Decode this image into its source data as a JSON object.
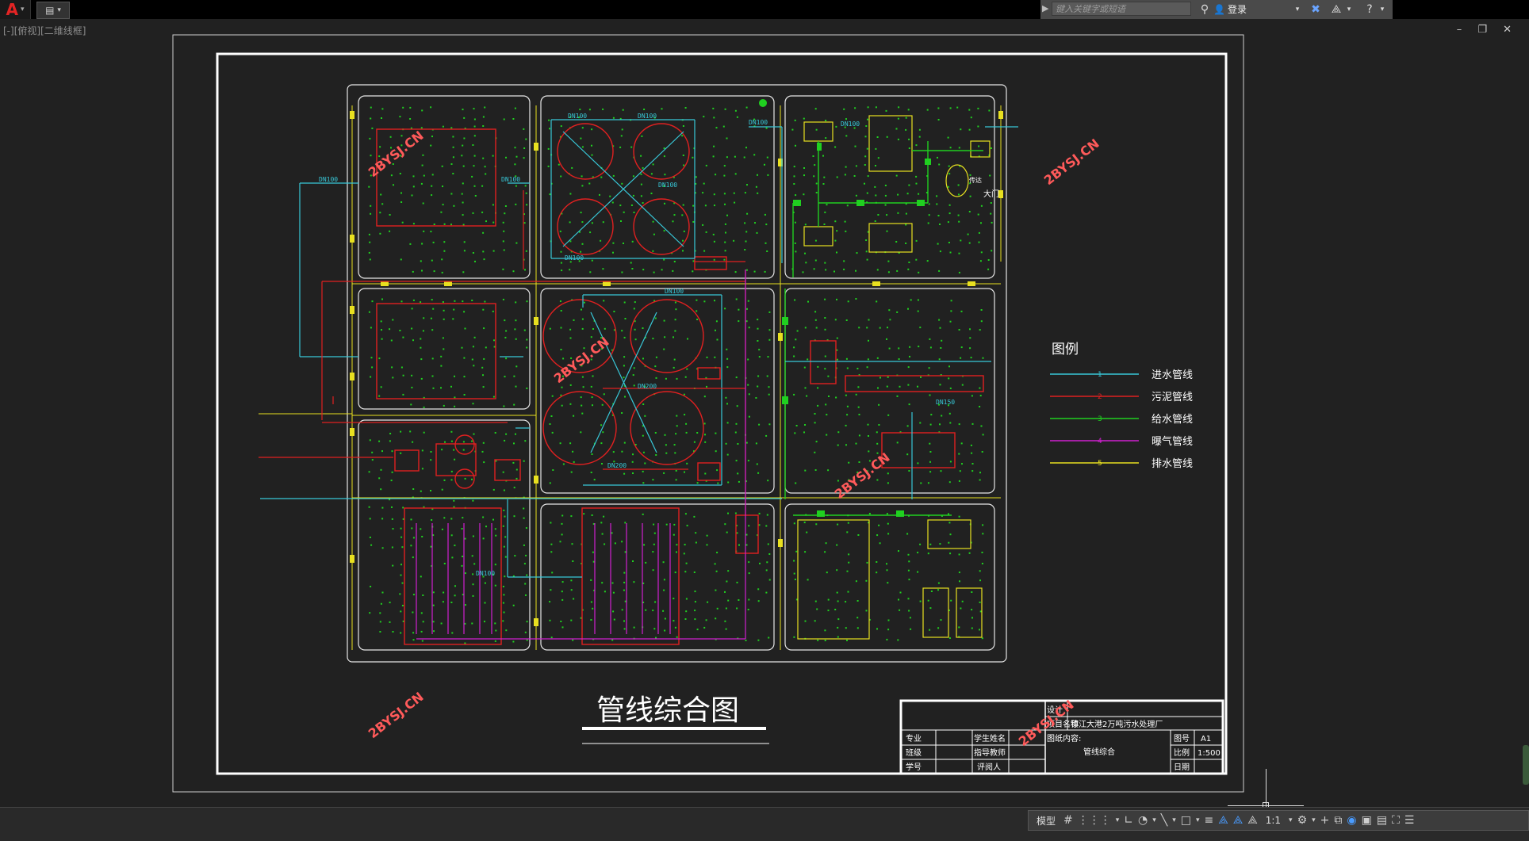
{
  "app": {
    "quick_access_icon": "save-icon",
    "search_placeholder": "键入关键字或短语",
    "login_label": "登录",
    "viewport_label": "[-][俯视][二维线框]",
    "window_controls": "– ❐ ✕"
  },
  "drawing": {
    "title": "管线综合图",
    "watermark": "2BYSJ.CN",
    "legend": {
      "heading": "图例",
      "items": [
        {
          "num": "1",
          "label": "进水管线",
          "color": "#38c8d8"
        },
        {
          "num": "2",
          "label": "污泥管线",
          "color": "#e02020"
        },
        {
          "num": "3",
          "label": "给水管线",
          "color": "#20d020"
        },
        {
          "num": "4",
          "label": "曝气管线",
          "color": "#d020d0"
        },
        {
          "num": "5",
          "label": "排水管线",
          "color": "#e8e020"
        }
      ]
    },
    "pipe_labels": [
      "DN100",
      "DN100",
      "DN100",
      "DN100",
      "DN100",
      "DN100",
      "DN100",
      "DN100",
      "DN200",
      "DN200",
      "DN100",
      "DN150",
      "DN100"
    ],
    "gate_label": "大门",
    "guard_label": "传达",
    "title_block": {
      "design": "设计",
      "project_label": "项目名称",
      "project_value": "镇江大港2万吨污水处理厂",
      "content_label": "图纸内容:",
      "content_value": "管线综合",
      "drawing_no_label": "图号",
      "drawing_no_value": "A1",
      "scale_label": "比例",
      "scale_value": "1:500",
      "date_label": "日期",
      "major_label": "专业",
      "student_label": "学生姓名",
      "class_label": "班级",
      "advisor_label": "指导教师",
      "id_label": "学号",
      "reviewer_label": "评阅人"
    }
  },
  "status": {
    "model_label": "模型",
    "scale_label": "1:1"
  },
  "colors": {
    "cyan": "#38c8d8",
    "red": "#e02020",
    "green": "#20d020",
    "magenta": "#d020d0",
    "yellow": "#e8e020",
    "line": "#e6e6e6",
    "watermark": "#ff5a5a"
  }
}
